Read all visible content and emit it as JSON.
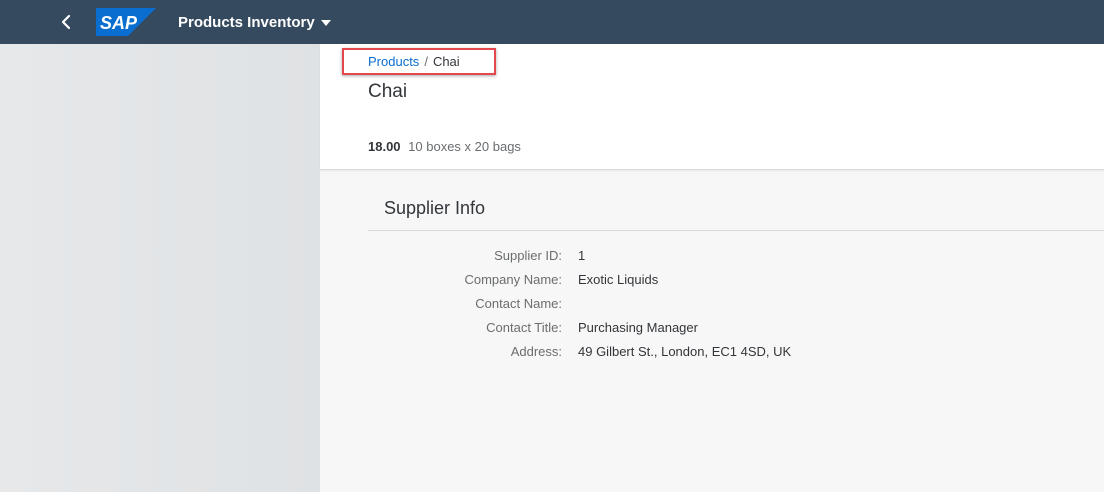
{
  "shell": {
    "logo_text": "SAP",
    "app_title": "Products Inventory",
    "colors": {
      "shell_bg": "#354a5f",
      "logo_blue": "#0a6ed1"
    }
  },
  "breadcrumb": {
    "link": "Products",
    "separator": "/",
    "current": "Chai"
  },
  "header": {
    "title": "Chai",
    "price": "18.00",
    "unit": "10 boxes x 20 bags"
  },
  "section": {
    "title": "Supplier Info",
    "fields": [
      {
        "label": "Supplier ID:",
        "value": "1"
      },
      {
        "label": "Company Name:",
        "value": "Exotic Liquids"
      },
      {
        "label": "Contact Name:",
        "value": ""
      },
      {
        "label": "Contact Title:",
        "value": "Purchasing Manager"
      },
      {
        "label": "Address:",
        "value": "49 Gilbert St., London, EC1 4SD, UK"
      }
    ]
  },
  "icons": {
    "back": "back-chevron-icon",
    "dropdown": "caret-down-icon"
  }
}
